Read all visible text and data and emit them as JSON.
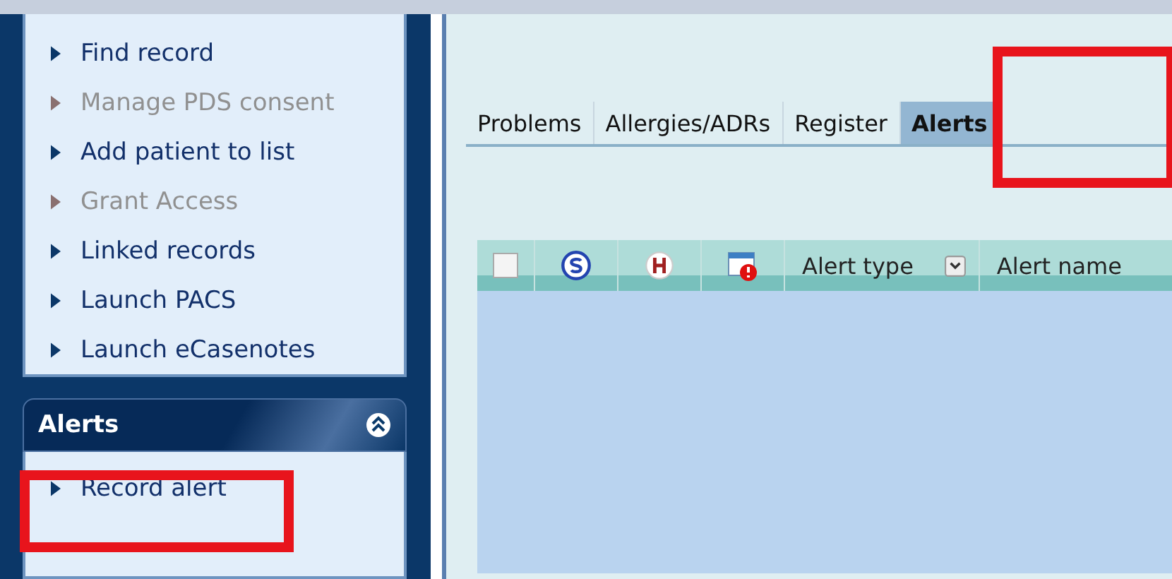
{
  "sidebar": {
    "items": [
      {
        "label": "Find record",
        "disabled": false
      },
      {
        "label": "Manage PDS consent",
        "disabled": true
      },
      {
        "label": "Add patient to list",
        "disabled": false
      },
      {
        "label": "Grant Access",
        "disabled": true
      },
      {
        "label": "Linked records",
        "disabled": false
      },
      {
        "label": "Launch PACS",
        "disabled": false
      },
      {
        "label": "Launch eCasenotes",
        "disabled": false
      }
    ]
  },
  "alerts_panel": {
    "title": "Alerts",
    "expanded": true,
    "items": [
      {
        "label": "Record alert",
        "disabled": false
      }
    ]
  },
  "tabs": [
    {
      "label": "Problems",
      "selected": false
    },
    {
      "label": "Allergies/ADRs",
      "selected": false
    },
    {
      "label": "Register",
      "selected": false
    },
    {
      "label": "Alerts",
      "selected": true
    }
  ],
  "table": {
    "columns": [
      {
        "kind": "checkbox",
        "checked": false
      },
      {
        "kind": "s-icon"
      },
      {
        "kind": "h-icon"
      },
      {
        "kind": "calendar-icon"
      },
      {
        "kind": "text",
        "label": "Alert type"
      },
      {
        "kind": "sort"
      },
      {
        "kind": "text",
        "label": "Alert name"
      }
    ]
  }
}
